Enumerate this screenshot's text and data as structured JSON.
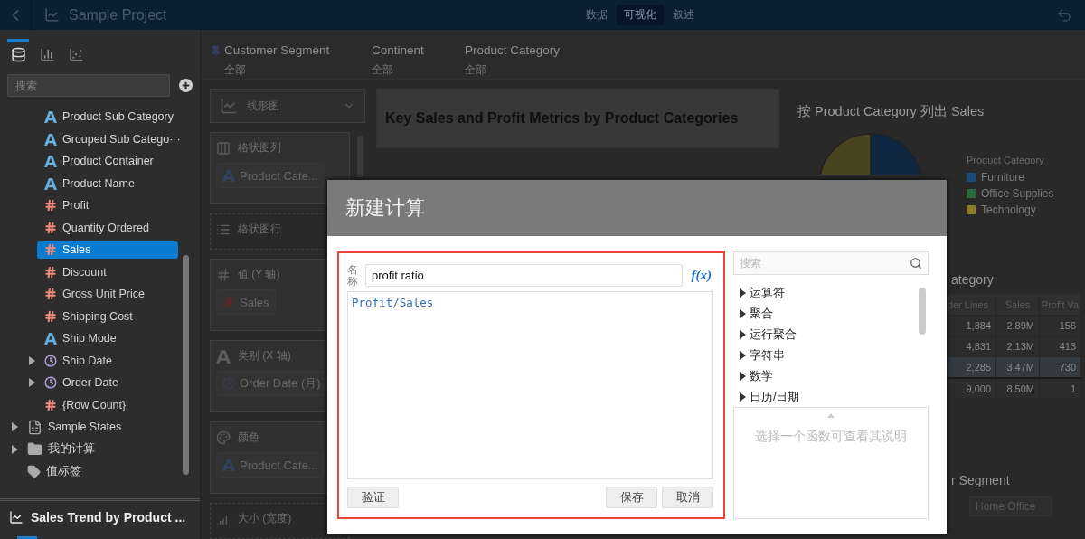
{
  "top_bar": {
    "project_title": "Sample Project",
    "tabs": [
      {
        "label": "数据",
        "selected": false
      },
      {
        "label": "可视化",
        "selected": true
      },
      {
        "label": "叙述",
        "selected": false
      }
    ]
  },
  "sidebar": {
    "tabs": [
      {
        "kind": "data",
        "selected": true
      },
      {
        "kind": "charts",
        "selected": false
      },
      {
        "kind": "insights",
        "selected": false
      }
    ],
    "search": {
      "placeholder": "搜索"
    },
    "fields": [
      {
        "name": "Product Sub Category",
        "kind": "text",
        "selected": false
      },
      {
        "name": "Grouped Sub Catego···",
        "kind": "text",
        "selected": false
      },
      {
        "name": "Product Container",
        "kind": "text",
        "selected": false
      },
      {
        "name": "Product Name",
        "kind": "text",
        "selected": false
      },
      {
        "name": "Profit",
        "kind": "number",
        "selected": false
      },
      {
        "name": "Quantity Ordered",
        "kind": "number",
        "selected": false
      },
      {
        "name": "Sales",
        "kind": "number",
        "selected": true
      },
      {
        "name": "Discount",
        "kind": "number",
        "selected": false
      },
      {
        "name": "Gross Unit Price",
        "kind": "number",
        "selected": false
      },
      {
        "name": "Shipping Cost",
        "kind": "number",
        "selected": false
      },
      {
        "name": "Ship Mode",
        "kind": "text",
        "selected": false
      },
      {
        "name": "Ship Date",
        "kind": "date",
        "selected": false,
        "expanded": false
      },
      {
        "name": "Order Date",
        "kind": "date",
        "selected": false,
        "expanded": false
      },
      {
        "name": "{Row Count}",
        "kind": "number",
        "selected": false
      }
    ],
    "sources": [
      {
        "label": "Sample States",
        "kind": "sheet",
        "expanded": false
      },
      {
        "label": "我的计算",
        "kind": "folder",
        "expanded": false
      },
      {
        "label": "值标签",
        "kind": "tag"
      }
    ],
    "sheet_title": "Sales Trend by Product ..."
  },
  "filters": [
    {
      "label": "Customer Segment",
      "pinned": true,
      "value": "全部"
    },
    {
      "label": "Continent",
      "pinned": false,
      "value": "全部"
    },
    {
      "label": "Product Category",
      "pinned": false,
      "value": "全部"
    }
  ],
  "shelves": {
    "chart_type": "线形图",
    "slots": [
      {
        "label": "格状图列",
        "kind": "columns",
        "pill": {
          "label": "Product Cate...",
          "kind": "text"
        }
      },
      {
        "label": "格状图行",
        "kind": "rows"
      },
      {
        "label": "值 (Y 轴)",
        "kind": "value",
        "pill": {
          "label": "Sales",
          "kind": "number"
        }
      },
      {
        "label": "类别 (X 轴)",
        "kind": "category",
        "pill": {
          "label": "Order Date (月)",
          "kind": "date"
        }
      },
      {
        "label": "颜色",
        "kind": "color",
        "pill": {
          "label": "Product Cate...",
          "kind": "text"
        }
      },
      {
        "label": "大小 (宽度)",
        "kind": "size"
      }
    ]
  },
  "canvas": {
    "title_card": "Key Sales and Profit Metrics by Product Categories",
    "pie_title": "按 Product Category 列出 Sales",
    "legend": {
      "title": "Product Category",
      "items": [
        {
          "label": "Furniture",
          "color": "#1b4a78"
        },
        {
          "label": "Office Supplies",
          "color": "#2e6a3a"
        },
        {
          "label": "Technology",
          "color": "#8c7b27"
        }
      ]
    },
    "table_title": "ategory",
    "table": {
      "columns": [
        "der Lines",
        "Sales",
        "Profit Va"
      ],
      "rows": [
        {
          "cells": [
            "1,884",
            "2.89M",
            "156"
          ],
          "selected": false,
          "kind": "data"
        },
        {
          "cells": [
            "4,831",
            "2.13M",
            "413"
          ],
          "selected": false,
          "kind": "data"
        },
        {
          "cells": [
            "2,285",
            "3.47M",
            "730"
          ],
          "selected": true,
          "kind": "data"
        },
        {
          "cells": [
            "9,000",
            "8.50M",
            "1"
          ],
          "selected": false,
          "kind": "total"
        }
      ]
    },
    "segment_title": "r Segment",
    "segment_tab": "Home Office"
  },
  "dialog": {
    "title": "新建计算",
    "name_label": "名称",
    "name_value": "profit ratio",
    "function_button": "f(x)",
    "formula": "Profit/Sales",
    "validate": "验证",
    "save": "保存",
    "cancel": "取消",
    "search": {
      "placeholder": "搜索"
    },
    "functions": [
      {
        "label": "运算符",
        "expanded": false
      },
      {
        "label": "聚合",
        "expanded": false
      },
      {
        "label": "运行聚合",
        "expanded": false
      },
      {
        "label": "字符串",
        "expanded": false
      },
      {
        "label": "数学",
        "expanded": false
      },
      {
        "label": "日历/日期",
        "expanded": false
      }
    ],
    "description_placeholder": "选择一个函数可查看其说明"
  }
}
